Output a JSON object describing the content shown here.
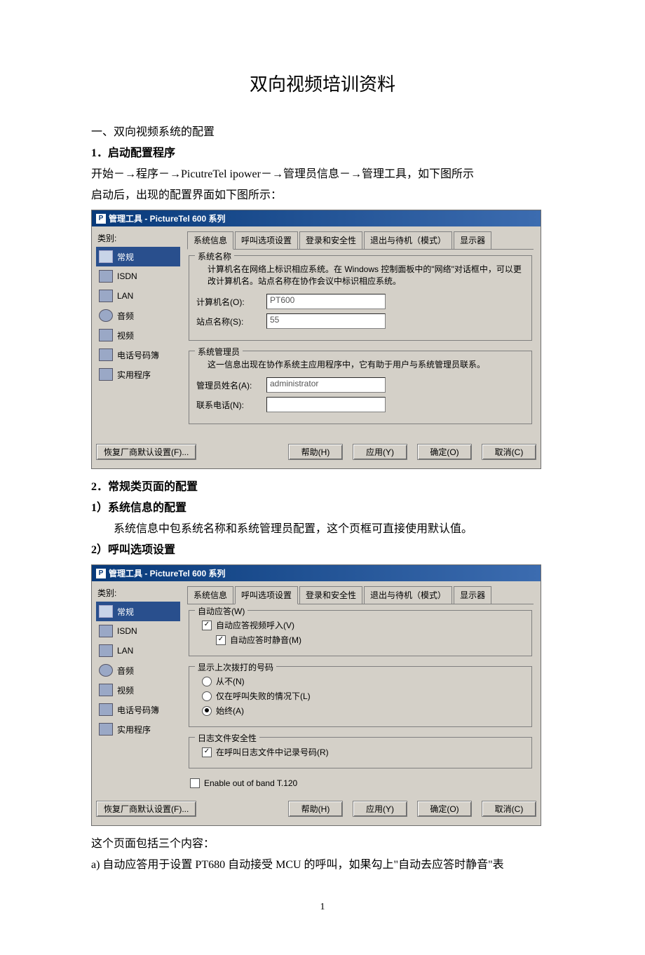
{
  "doc": {
    "title": "双向视频培训资料",
    "section1_heading": "一、双向视频系统的配置",
    "step1_heading": "1．启动配置程序",
    "step1_line1": "开始－→程序－→PicutreTel ipower－→管理员信息－→管理工具，如下图所示",
    "step1_line2": "启动后，出现的配置界面如下图所示：",
    "step2_heading": "2．常规类页面的配置",
    "step2_sub1": "1）系统信息的配置",
    "step2_sub1_text": "系统信息中包系统名称和系统管理员配置，这个页框可直接使用默认值。",
    "step2_sub2": "2）呼叫选项设置",
    "after_win2_line1": "这个页面包括三个内容：",
    "after_win2_line2": "a)  自动应答用于设置 PT680 自动接受 MCU 的呼叫，如果勾上\"自动去应答时静音\"表",
    "page_number": "1"
  },
  "win_common": {
    "title": "管理工具 - PictureTel 600 系列",
    "category_label": "类别:",
    "sidebar": [
      {
        "label": "常规"
      },
      {
        "label": "ISDN"
      },
      {
        "label": "LAN"
      },
      {
        "label": "音频"
      },
      {
        "label": "视频"
      },
      {
        "label": "电话号码簿"
      },
      {
        "label": "实用程序"
      }
    ],
    "restore_btn": "恢复厂商默认设置(F)...",
    "help_btn": "帮助(H)",
    "apply_btn": "应用(Y)",
    "ok_btn": "确定(O)",
    "cancel_btn": "取消(C)"
  },
  "win1": {
    "tabs": [
      "系统信息",
      "呼叫选项设置",
      "登录和安全性",
      "退出与待机（模式）",
      "显示器"
    ],
    "active_tab": 0,
    "group1_legend": "系统名称",
    "group1_desc": "计算机名在网络上标识相应系统。在 Windows 控制面板中的\"网络\"对话框中，可以更改计算机名。站点名称在协作会议中标识相应系统。",
    "field_computer_label": "计算机名(O):",
    "field_computer_value": "PT600",
    "field_site_label": "站点名称(S):",
    "field_site_value": "55",
    "group2_legend": "系统管理员",
    "group2_desc": "这一信息出现在协作系统主应用程序中，它有助于用户与系统管理员联系。",
    "field_admin_label": "管理员姓名(A):",
    "field_admin_value": "administrator",
    "field_phone_label": "联系电话(N):",
    "field_phone_value": ""
  },
  "win2": {
    "tabs": [
      "系统信息",
      "呼叫选项设置",
      "登录和安全性",
      "退出与待机（模式）",
      "显示器"
    ],
    "active_tab": 1,
    "group_auto_legend": "自动应答(W)",
    "auto_answer_label": "自动应答视频呼入(V)",
    "auto_mute_label": "自动应答时静音(M)",
    "group_lastdial_legend": "显示上次拨打的号码",
    "opt_never": "从不(N)",
    "opt_fail": "仅在呼叫失败的情况下(L)",
    "opt_always": "始终(A)",
    "group_log_legend": "日志文件安全性",
    "log_record_label": "在呼叫日志文件中记录号码(R)",
    "t120_label": "Enable out of band T.120"
  }
}
